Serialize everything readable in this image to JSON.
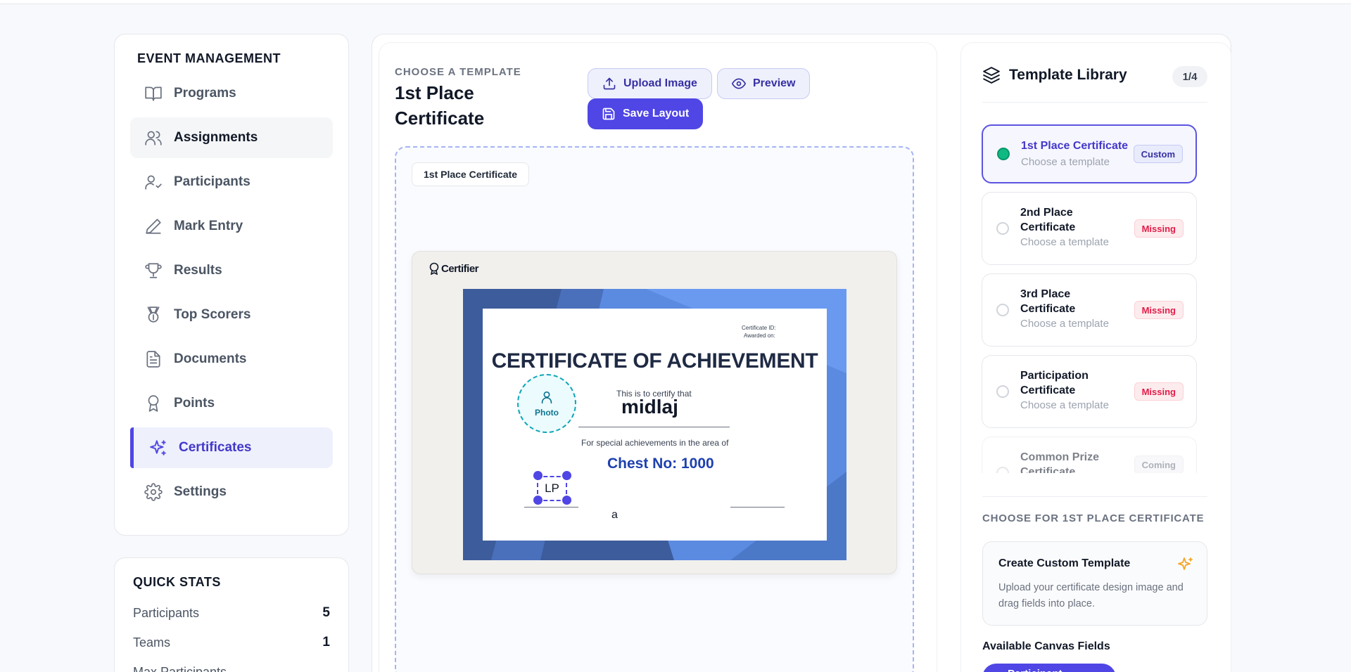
{
  "sidebar": {
    "title": "EVENT MANAGEMENT",
    "items": [
      {
        "label": "Programs",
        "icon": "book-icon"
      },
      {
        "label": "Assignments",
        "icon": "users-icon"
      },
      {
        "label": "Participants",
        "icon": "user-check-icon"
      },
      {
        "label": "Mark Entry",
        "icon": "pen-icon"
      },
      {
        "label": "Results",
        "icon": "trophy-icon"
      },
      {
        "label": "Top Scorers",
        "icon": "medal-icon"
      },
      {
        "label": "Documents",
        "icon": "document-icon"
      },
      {
        "label": "Points",
        "icon": "award-icon"
      },
      {
        "label": "Certificates",
        "icon": "sparkles-icon"
      },
      {
        "label": "Settings",
        "icon": "gear-icon"
      }
    ],
    "active_index": 8
  },
  "quick_stats": {
    "title": "QUICK STATS",
    "rows": [
      {
        "label": "Participants",
        "value": "5"
      },
      {
        "label": "Teams",
        "value": "1"
      },
      {
        "label": "Max Participants",
        "value": ""
      }
    ]
  },
  "editor": {
    "eyebrow": "CHOOSE A TEMPLATE",
    "title": "1st Place Certificate",
    "upload_label": "Upload Image",
    "preview_label": "Preview",
    "save_label": "Save Layout",
    "canvas_tag": "1st Place Certificate"
  },
  "certificate": {
    "brand": "Certifier",
    "id_label": "Certificate ID:",
    "awarded_label": "Awarded on:",
    "heading": "CERTIFICATE OF ACHIEVEMENT",
    "certify_text": "This is to certify that",
    "name": "midlaj",
    "special_text": "For special achievements in the area of",
    "chest_no": "Chest No: 1000",
    "photo_label": "Photo",
    "lp_field": "LP",
    "a_field": "a"
  },
  "library": {
    "title": "Template Library",
    "count": "1/4",
    "items": [
      {
        "name": "1st Place Certificate",
        "sub": "Choose a template",
        "badge": "Custom"
      },
      {
        "name": "2nd Place Certificate",
        "sub": "Choose a template",
        "badge": "Missing"
      },
      {
        "name": "3rd Place Certificate",
        "sub": "Choose a template",
        "badge": "Missing"
      },
      {
        "name": "Participation Certificate",
        "sub": "Choose a template",
        "badge": "Missing"
      },
      {
        "name": "Common Prize Certificate",
        "sub": "",
        "badge": "Coming"
      }
    ],
    "choose_label": "CHOOSE FOR 1ST PLACE CERTIFICATE",
    "custom_title": "Create Custom Template",
    "custom_desc": "Upload your certificate design image and drag fields into place.",
    "available_label": "Available Canvas Fields",
    "available_button": "Participant Name"
  },
  "colors": {
    "accent": "#4f46e5",
    "success": "#10b981",
    "danger": "#e11d48"
  }
}
